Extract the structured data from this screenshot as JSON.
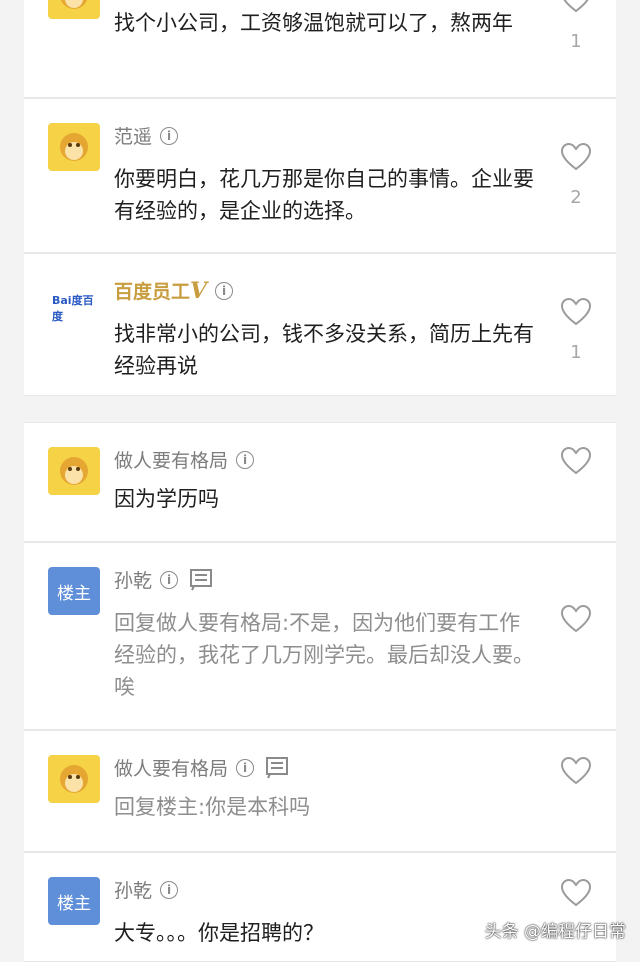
{
  "comments": [
    {
      "username": "",
      "text": "找个小公司，工资够温饱就可以了，熬两年",
      "likes": "1"
    },
    {
      "username": "范遥",
      "text": "你要明白，花几万那是你自己的事情。企业要有经验的，是企业的选择。",
      "likes": "2"
    },
    {
      "username": "百度员工",
      "text": "找非常小的公司，钱不多没关系，简历上先有经验再说",
      "likes": "1",
      "badge": "V",
      "avatar_text": "Bai度百度"
    },
    {
      "username": "做人要有格局",
      "text": "因为学历吗"
    },
    {
      "username": "孙乾",
      "avatar_text": "楼主",
      "text": "回复做人要有格局:不是，因为他们要有工作经验的，我花了几万刚学完。最后却没人要。唉"
    },
    {
      "username": "做人要有格局",
      "text": "回复楼主:你是本科吗"
    },
    {
      "username": "孙乾",
      "avatar_text": "楼主",
      "text": "大专。。。你是招聘的？"
    }
  ],
  "info_glyph": "i",
  "watermark": "头条 @编程仔日常",
  "colors": {
    "accent_gold": "#c89d3f",
    "owner_avatar": "#5f8fd9",
    "monkey_avatar": "#f6d247"
  }
}
